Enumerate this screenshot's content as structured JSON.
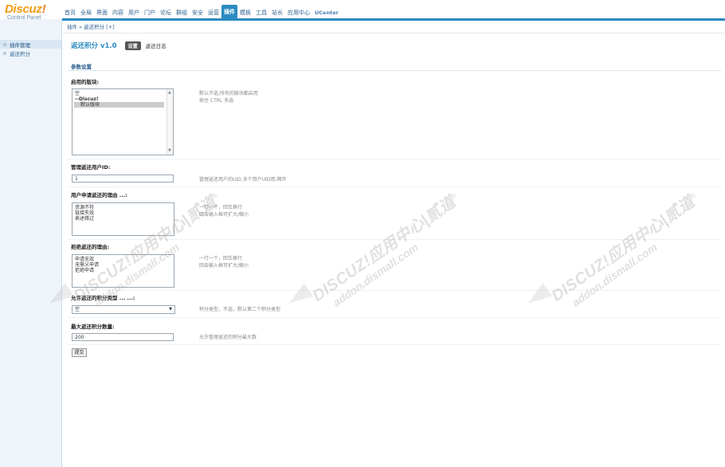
{
  "logo": {
    "brand": "Discuz",
    "exclaim": "!",
    "sub": "Control Panel"
  },
  "topnav": [
    "首页",
    "全局",
    "界面",
    "内容",
    "用户",
    "门户",
    "论坛",
    "群组",
    "安全",
    "运营",
    "插件",
    "模板",
    "工具",
    "站长",
    "应用中心",
    "UCenter"
  ],
  "topnav_active_index": 10,
  "breadcrumb": "插件 » 返还积分 [+]",
  "sidebar": {
    "items": [
      "插件管理",
      "返还积分"
    ],
    "active_index": 0
  },
  "plugin": {
    "title": "返还积分 v1.0",
    "tab_active": "设置",
    "tab_other": "返还日志"
  },
  "section_title": "参数设置",
  "fields": {
    "enabled_forums": {
      "label": "启用的版块:",
      "options": [
        "空",
        "--Discuz!",
        "   默认版块"
      ],
      "selected_index": 2,
      "hint1": "默认不选,所有的版块都启用",
      "hint2": "按住 CTRL 多选"
    },
    "admin_uid": {
      "label": "管理返还用户ID:",
      "value": "1",
      "hint": "管理返还用户的UID,多个用户UID用,隔开"
    },
    "apply_reasons": {
      "label": "用户申请返还的理由 ...:",
      "lines": [
        "资源不符",
        "链接失效",
        "表述錯过"
      ],
      "hint1": "一行一个，回车换行",
      "hint2": "回击输入框可扩大/缩小"
    },
    "reject_reasons": {
      "label": "拒绝返还的理由:",
      "lines": [
        "申请无效",
        "无需义申请",
        "拒绝申请"
      ],
      "hint1": "一行一个，回车换行",
      "hint2": "回击输入框可扩大/缩小"
    },
    "credit_type": {
      "label": "允许返还的积分类型 ... ...:",
      "value": "空",
      "hint": "积分类型，不选，默认第二个积分类型"
    },
    "max_credit": {
      "label": "最大返还积分数量:",
      "value": "200",
      "hint": "允许管理返还的积分最大数"
    }
  },
  "submit_label": "提交",
  "watermark": {
    "line1": "DISCUZ!应用中心|贰道",
    "reg": "®",
    "line2": "addon.dismall.com"
  },
  "colors": {
    "accent": "#2b8ac0",
    "logo": "#f39c12"
  }
}
